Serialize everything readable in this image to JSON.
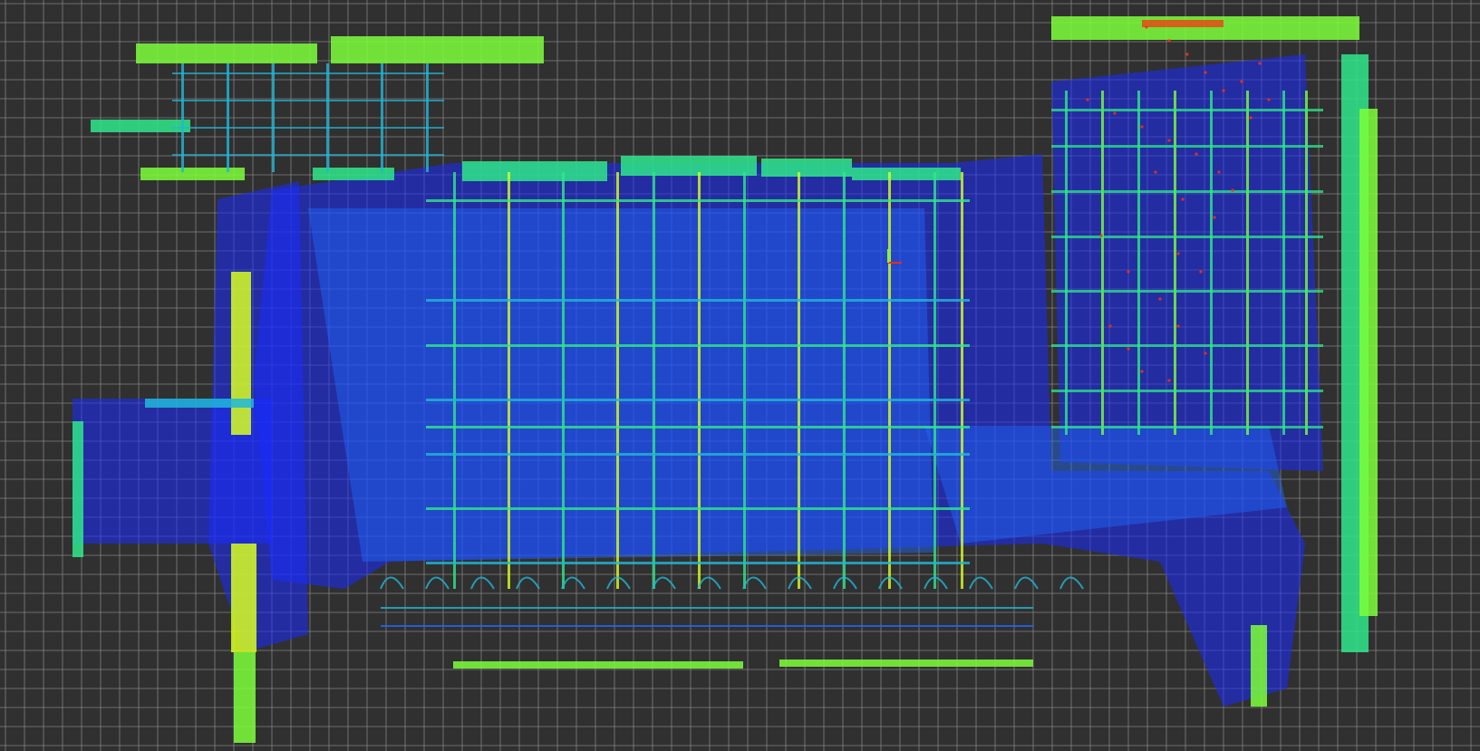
{
  "viewer": {
    "background_color": "#303030",
    "grid_color": "#9a9a9a",
    "colormap": [
      "#1a2cff",
      "#1e6bff",
      "#20b8d8",
      "#2ee88a",
      "#7cff3a",
      "#d8ff22",
      "#ff2a10"
    ],
    "features": {
      "grid_visible": true,
      "axes_marker_visible": true,
      "point_cloud_visible": true
    }
  }
}
